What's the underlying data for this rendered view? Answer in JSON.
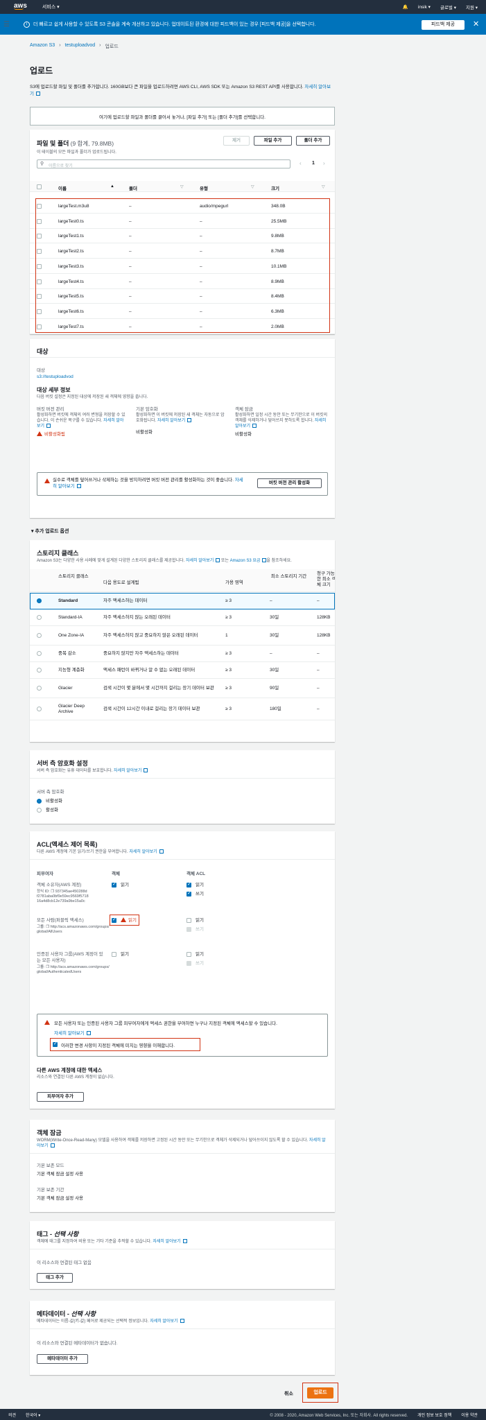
{
  "nav": {
    "logo": "aws",
    "services": "서비스 ▾",
    "user": "insik ▾",
    "region": "글로벌 ▾",
    "support": "지원 ▾"
  },
  "banner": {
    "text": "더 빠르고 쉽게 사용할 수 있도록 S3 콘솔을 계속 개선하고 있습니다. 업데이트된 환경에 대한 피드백이 있는 경우 [피드백 제공]을 선택합니다.",
    "button": "피드백 제공"
  },
  "breadcrumb": [
    "Amazon S3",
    "testuploadvod",
    "업로드"
  ],
  "page": {
    "title": "업로드",
    "intro": "S3에 업로드할 파일 및 폴더를 추가합니다. 160GB보다 큰 파일을 업로드하려면 AWS CLI, AWS SDK 또는 Amazon S3 REST API를 사용합니다.",
    "intro_link": "자세히 알아보기"
  },
  "dropzone": {
    "text": "여기에 업로드할 파일과 폴더를 끌어서 놓거나, [파일 추가] 또는 [폴더 추가]를 선택합니다."
  },
  "files": {
    "title": "파일 및 폴더",
    "count": "(9 합계, 79.8MB)",
    "subtitle": "이 테이블의 모든 파일과 폴더가 업로드됩니다.",
    "remove": "제거",
    "add_files": "파일 추가",
    "add_folder": "폴더 추가",
    "search_placeholder": "이름으로 찾기",
    "page": "1",
    "headers": [
      "이름",
      "폴더",
      "유형",
      "크기"
    ],
    "rows": [
      {
        "name": "largeTest.m3u8",
        "folder": "–",
        "type": "audio/mpegurl",
        "size": "348.0B"
      },
      {
        "name": "largeTest0.ts",
        "folder": "–",
        "type": "–",
        "size": "25.5MB"
      },
      {
        "name": "largeTest1.ts",
        "folder": "–",
        "type": "–",
        "size": "9.8MB"
      },
      {
        "name": "largeTest2.ts",
        "folder": "–",
        "type": "–",
        "size": "8.7MB"
      },
      {
        "name": "largeTest3.ts",
        "folder": "–",
        "type": "–",
        "size": "10.1MB"
      },
      {
        "name": "largeTest4.ts",
        "folder": "–",
        "type": "–",
        "size": "8.9MB"
      },
      {
        "name": "largeTest5.ts",
        "folder": "–",
        "type": "–",
        "size": "8.4MB"
      },
      {
        "name": "largeTest6.ts",
        "folder": "–",
        "type": "–",
        "size": "6.3MB"
      },
      {
        "name": "largeTest7.ts",
        "folder": "–",
        "type": "–",
        "size": "2.0MB"
      }
    ]
  },
  "destination": {
    "title": "대상",
    "label": "대상",
    "value": "s3://testuploadvod",
    "details_title": "대상 세부 정보",
    "details_sub": "다음 버킷 설정은 지정된 대상에 저장된 새 객체에 영향을 줍니다.",
    "versioning_title": "버킷 버전 관리",
    "versioning_desc": "활성화하면 버킷에 객체의 여러 변형을 저장할 수 있습니다. 이 손쉬운 복구를 수 있습니다.",
    "versioning_link": "자세히 알아보기",
    "versioning_value": "비활성화됨",
    "encryption_title": "기본 암호화",
    "encryption_desc": "활성화하면 이 버킷에 저장된 새 객체는 자동으로 암호화됩니다.",
    "encryption_link": "자세히 알아보기",
    "encryption_value": "비활성화",
    "lock_title": "객체 잠금",
    "lock_desc": "활성화하면 일정 시간 동안 또는 무기한으로 이 버킷의 객체를 삭제하거나 덮어쓰지 못하도록 합니다.",
    "lock_link": "자세히 알아보기",
    "lock_value": "비활성화",
    "alert_text": "실수로 객체를 덮어쓰거나 삭제하는 것을 방지하려면 버킷 버전 관리를 활성화하는 것이 좋습니다.",
    "alert_link": "자세히 알아보기",
    "alert_button": "버킷 버전 관리 활성화"
  },
  "options_toggle": "▾ 추가 업로드 옵션",
  "storage": {
    "title": "스토리지 클래스",
    "subtitle": "Amazon S3는 다양한 사용 사례에 맞게 설계된 다양한 스토리지 클래스를 제공합니다.",
    "link1": "자세히 알아보기",
    "link2": "Amazon S3 요금",
    "headers": [
      "스토리지 클래스",
      "다음 용도로 설계됨",
      "가용 영역",
      "최소 스토리지 기간",
      "청구 가능한 최소 객체 크기"
    ],
    "rows": [
      {
        "name": "Standard",
        "desc": "자주 액세스하는 데이터",
        "az": "≥ 3",
        "min": "–",
        "size": "–"
      },
      {
        "name": "Standard-IA",
        "desc": "자주 액세스하지 않는 오래된 데이터",
        "az": "≥ 3",
        "min": "30일",
        "size": "128KB"
      },
      {
        "name": "One Zone-IA",
        "desc": "자주 액세스하지 않고 중요하지 않은 오래된 데이터",
        "az": "1",
        "min": "30일",
        "size": "128KB"
      },
      {
        "name": "중복 감소",
        "desc": "중요하지 않지만 자주 액세스하는 데이터",
        "az": "≥ 3",
        "min": "–",
        "size": "–"
      },
      {
        "name": "지능형 계층화",
        "desc": "액세스 패턴이 바뀌거나 알 수 없는 오래된 데이터",
        "az": "≥ 3",
        "min": "30일",
        "size": "–"
      },
      {
        "name": "Glacier",
        "desc": "검색 시간이 몇 분에서 몇 시간까지 걸리는 장기 데이터 보관",
        "az": "≥ 3",
        "min": "90일",
        "size": "–"
      },
      {
        "name": "Glacier Deep Archive",
        "desc": "검색 시간이 12시간 이내로 걸리는 장기 데이터 보관",
        "az": "≥ 3",
        "min": "180일",
        "size": "–"
      }
    ]
  },
  "sse": {
    "title": "서버 측 암호화 설정",
    "subtitle": "서버 측 암호화는 유휴 데이터를 보호합니다.",
    "link": "자세히 알아보기",
    "label": "서버 측 암호화",
    "opt_disable": "비활성화",
    "opt_enable": "활성화"
  },
  "acl": {
    "title": "ACL(액세스 제어 목록)",
    "subtitle": "다른 AWS 계정에 기본 읽기/쓰기 권한을 부여합니다.",
    "link": "자세히 알아보기",
    "col_grantee": "피부여자",
    "col_object": "객체",
    "col_object_acl": "객체 ACL",
    "owner_label": "객체 소유자(AWS 계정)",
    "owner_id_label": "정식 ID:",
    "owner_id": "937345ae450288d f2781aba0bf9e59ec9569f5718 16a4d8cb12e739a9be15a0c",
    "everyone_label": "모든 사람(퍼블릭 액세스)",
    "everyone_group_label": "그룹:",
    "everyone_group": "http://acs.amazonaws.com/groups/global/AllUsers",
    "auth_label": "인증된 사용자 그룹(AWS 계정이 있는 모든 사용자)",
    "auth_group_label": "그룹:",
    "auth_group": "http://acs.amazonaws.com/groups/global/AuthenticatedUsers",
    "read": "읽기",
    "write": "쓰기",
    "warn_text": "모든 사용자 또는 인증된 사용자 그룹 피부여자에게 액세스 권한을 부여하면 누구나 지정된 객체에 액세스할 수 있습니다.",
    "warn_link": "자세히 알아보기",
    "ack": "이러한 변경 사항이 지정된 객체에 미치는 영향을 이해합니다.",
    "other_title": "다른 AWS 계정에 대한 액세스",
    "other_sub": "리소스와 연결된 다른 AWS 계정이 없습니다.",
    "add_grantee": "피부여자 추가"
  },
  "objlock": {
    "title": "객체 잠금",
    "subtitle": "WORM(Write-Once-Read-Many) 모델을 사용하여 객체를 저장하면 고정된 시간 동안 또는 무기한으로 객체가 삭제되거나 덮어쓰이지 않도록 할 수 있습니다.",
    "link": "자세히 알아보기",
    "mode_label": "기본 보존 모드",
    "mode_value": "기본 객체 잠금 설정 사용",
    "period_label": "기본 보존 기간",
    "period_value": "기본 객체 잠금 설정 사용"
  },
  "tags": {
    "title_main": "태그 - ",
    "title_opt": "선택 사항",
    "subtitle": "객체에 태그를 지정하여 비용 또는 기타 기준을 추적할 수 있습니다.",
    "link": "자세히 알아보기",
    "empty": "이 리소스와 연결된 태그 없음",
    "add": "태그 추가"
  },
  "metadata": {
    "title_main": "메타데이터 - ",
    "title_opt": "선택 사항",
    "subtitle": "메타데이터는 이름-값(키-값) 페어로 제공되는 선택적 정보입니다.",
    "link": "자세히 알아보기",
    "empty": "이 리소스와 연결된 메타데이터가 없습니다.",
    "add": "메타데이터 추가"
  },
  "actions": {
    "cancel": "취소",
    "upload": "업로드"
  },
  "footer": {
    "feedback": "의견",
    "language": "한국어 ▾",
    "copyright": "© 2008 - 2020, Amazon Web Services, Inc. 또는 자회사. All rights reserved.",
    "privacy": "개인 정보 보호 정책",
    "terms": "이용 약관"
  },
  "colors": {
    "nav": "#232f3e",
    "banner": "#0073bb",
    "primary": "#ec7211",
    "highlight": "#d13212",
    "link": "#0073bb"
  }
}
